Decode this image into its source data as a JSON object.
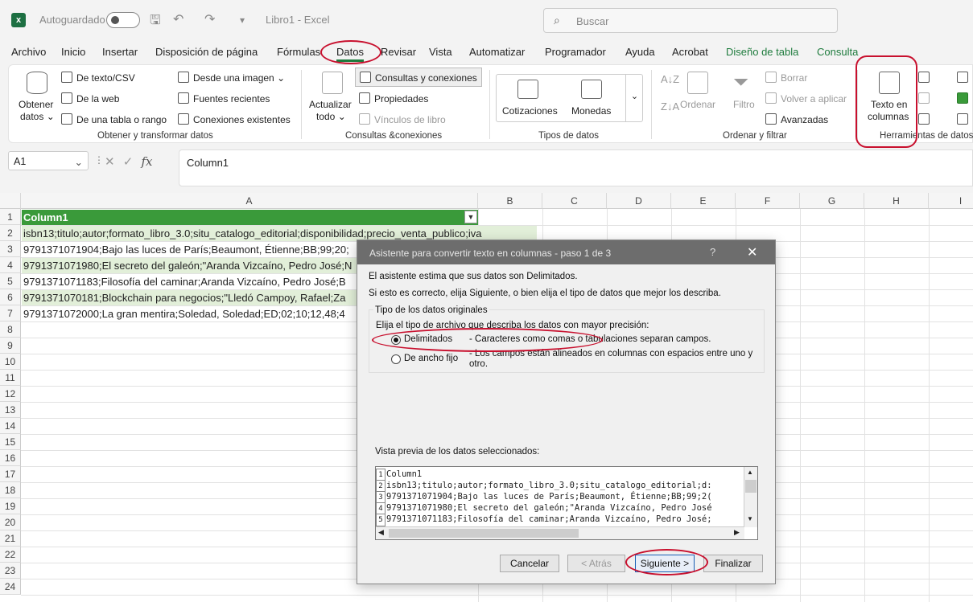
{
  "titlebar": {
    "autosave_label": "Autoguardado",
    "doc_title": "Libro1  -  Excel",
    "search_placeholder": "Buscar"
  },
  "menu": {
    "tabs": [
      "Archivo",
      "Inicio",
      "Insertar",
      "Disposición de página",
      "Fórmulas",
      "Datos",
      "Revisar",
      "Vista",
      "Automatizar",
      "Programador",
      "Ayuda",
      "Acrobat",
      "Diseño de tabla",
      "Consulta"
    ],
    "active": "Datos"
  },
  "ribbon": {
    "get_data": {
      "label1": "Obtener",
      "label2": "datos"
    },
    "from_text": "De texto/CSV",
    "from_web": "De la web",
    "from_table": "De una tabla o rango",
    "from_image": "Desde una imagen",
    "recent_sources": "Fuentes recientes",
    "existing_connections": "Conexiones existentes",
    "group1_label": "Obtener y transformar datos",
    "refresh": {
      "label1": "Actualizar",
      "label2": "todo"
    },
    "queries_connections": "Consultas y conexiones",
    "properties": "Propiedades",
    "book_links": "Vínculos de libro",
    "group2_label": "Consultas &conexiones",
    "stocks": "Cotizaciones",
    "currencies": "Monedas",
    "group3_label": "Tipos de datos",
    "sort": "Ordenar",
    "filter": "Filtro",
    "clear": "Borrar",
    "reapply": "Volver a aplicar",
    "advanced": "Avanzadas",
    "group4_label": "Ordenar y filtrar",
    "text_to_columns": {
      "label1": "Texto en",
      "label2": "columnas"
    },
    "group5_label": "Herramientas de datos"
  },
  "formula_bar": {
    "name_box": "A1",
    "fx": "fx",
    "content": "Column1"
  },
  "grid": {
    "columns": [
      "A",
      "B",
      "C",
      "D",
      "E",
      "F",
      "G",
      "H",
      "I"
    ],
    "rows": [
      "1",
      "2",
      "3",
      "4",
      "5",
      "6",
      "7",
      "8",
      "9",
      "10",
      "11",
      "12",
      "13",
      "14",
      "15",
      "16",
      "17",
      "18",
      "19",
      "20",
      "21",
      "22",
      "23",
      "24"
    ],
    "cells": [
      "Column1",
      "isbn13;titulo;autor;formato_libro_3.0;situ_catalogo_editorial;disponibilidad;precio_venta_publico;iva",
      "9791371071904;Bajo las luces de París;Beaumont, Étienne;BB;99;20;",
      "9791371071980;El secreto del galeón;\"Aranda Vizcaíno, Pedro José;N",
      "9791371071183;Filosofía del caminar;Aranda Vizcaíno, Pedro José;B",
      "9791371070181;Blockchain para negocios;\"Lledó Campoy, Rafael;Za",
      "9791371072000;La gran mentira;Soledad, Soledad;ED;02;10;12,48;4"
    ]
  },
  "dialog": {
    "title": "Asistente para convertir texto en columnas - paso 1 de 3",
    "help": "?",
    "close": "✕",
    "intro1": "El asistente estima que sus datos son Delimitados.",
    "intro2": "Si esto es correcto, elija Siguiente, o bien elija el tipo de datos que mejor los describa.",
    "group_title": "Tipo de los datos originales",
    "choose_label": "Elija el tipo de archivo que describa los datos con mayor precisión:",
    "opt_delimited": "Delimitados",
    "opt_delimited_desc": "- Caracteres como comas o tabulaciones separan campos.",
    "opt_fixed": "De ancho fijo",
    "opt_fixed_desc1": "- Los campos están alineados en columnas con espacios entre uno y",
    "opt_fixed_desc2": "otro.",
    "preview_label": "Vista previa de los datos seleccionados:",
    "preview_lines": [
      "Column1",
      "isbn13;titulo;autor;formato_libro_3.0;situ_catalogo_editorial;d:",
      "9791371071904;Bajo las luces de París;Beaumont, Étienne;BB;99;2(",
      "9791371071980;El secreto del galeón;\"Aranda Vizcaíno, Pedro José",
      "9791371071183;Filosofía del caminar;Aranda Vizcaíno, Pedro José;"
    ],
    "preview_nums": [
      "1",
      "2",
      "3",
      "4",
      "5"
    ],
    "btn_cancel": "Cancelar",
    "btn_back": "< Atrás",
    "btn_next": "Siguiente >",
    "btn_finish": "Finalizar"
  },
  "colors": {
    "excel_green": "#1e7b3d",
    "table_header": "#3a9a3a",
    "band": "#e2efd9",
    "annotation_red": "#c8102e"
  }
}
